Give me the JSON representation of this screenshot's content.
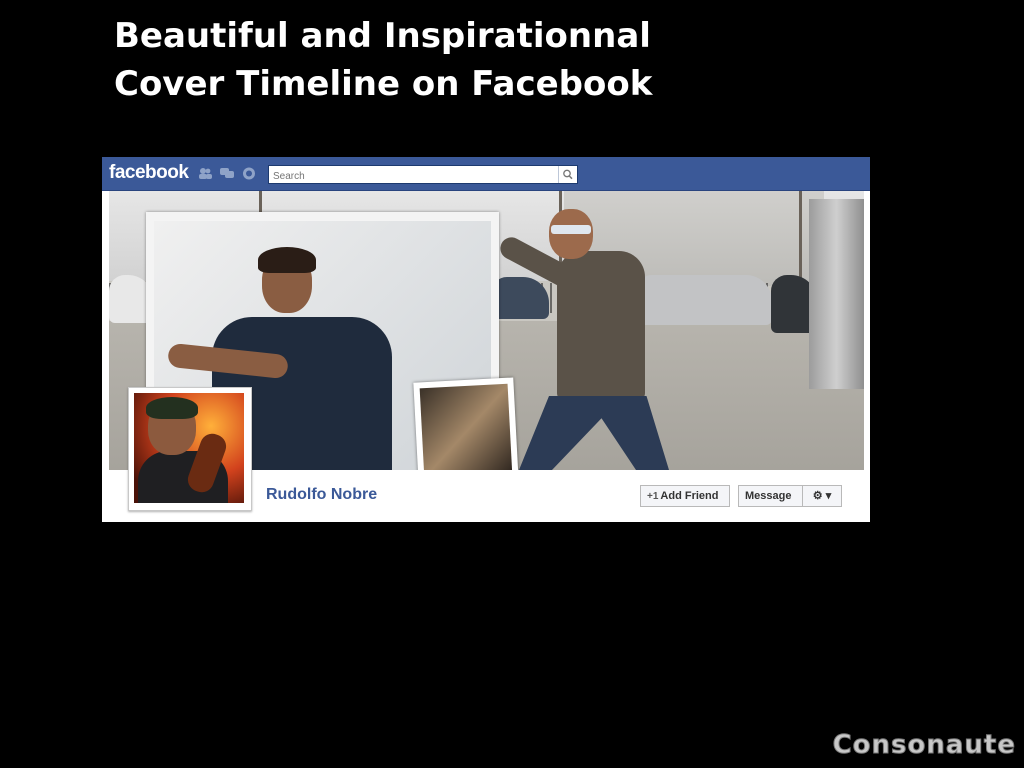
{
  "slide": {
    "title_line1": "Beautiful and Inspirationnal",
    "title_line2": "Cover Timeline on Facebook",
    "watermark": "Consonaute"
  },
  "facebook": {
    "logo": "facebook",
    "nav_icons": [
      "friend-requests-icon",
      "messages-icon",
      "notifications-icon"
    ],
    "search_placeholder": "Search",
    "brand_color": "#3b5998",
    "profile": {
      "name": "Rudolfo Nobre",
      "add_friend_label": "Add Friend",
      "message_label": "Message",
      "settings_icon": "gear-icon"
    }
  }
}
